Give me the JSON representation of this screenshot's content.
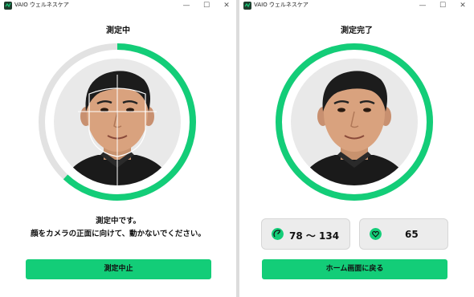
{
  "app": {
    "title": "VAIO ウェルネスケア"
  },
  "window_controls": {
    "minimize": "—",
    "maximize": "☐",
    "close": "✕"
  },
  "measuring": {
    "title": "測定中",
    "instruction_line1": "測定中です。",
    "instruction_line2": "顔をカメラの正面に向けて、動かないでください。",
    "stop_button": "測定中止",
    "progress_fraction": 0.62
  },
  "complete": {
    "title": "測定完了",
    "blood_pressure": "78 ～ 134",
    "heart_rate": "65",
    "home_button": "ホーム画面に戻る",
    "progress_fraction": 1.0
  },
  "colors": {
    "accent": "#13cd78",
    "track": "#e2e2e2",
    "card": "#ececec"
  },
  "icons": {
    "app": "vaio-app-icon",
    "bp": "blood-pressure-gauge-icon",
    "hr": "heart-icon"
  }
}
